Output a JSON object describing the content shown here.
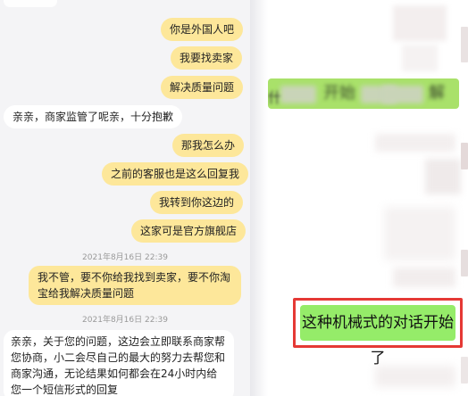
{
  "chat": {
    "messages": [
      {
        "side": "right",
        "text": "你是外国人吧"
      },
      {
        "side": "right",
        "text": "我要找卖家"
      },
      {
        "side": "right",
        "text": "解决质量问题"
      },
      {
        "side": "left",
        "text": "亲亲，商家监管了呢亲，十分抱歉"
      },
      {
        "side": "right",
        "text": "那我怎么办"
      },
      {
        "side": "right",
        "text": "之前的客服也是这么回复我"
      },
      {
        "side": "right",
        "text": "我转到你这边的"
      },
      {
        "side": "right",
        "text": "这家可是官方旗舰店"
      },
      {
        "side": "right",
        "text": "我不管，要不你给我找到卖家，要不你淘宝给我解决质量问题"
      },
      {
        "side": "left",
        "text": "亲亲，关于您的问题，这边会立即联系商家帮您协商，小二会尽自己的最大的努力去帮您和商家沟通，无论结果如何都会在24小时内给您一个短信形式的回复"
      }
    ],
    "timestamps": [
      "2021年8月16日 22:39",
      "2021年8月16日 22:39"
    ]
  },
  "right_panel": {
    "highlighted_message": "这种机械式的对话开始了",
    "blurred_fragment_1": "开始",
    "blurred_fragment_2": "解",
    "blurred_fragment_3": "什"
  },
  "colors": {
    "user_bubble": "#fde79a",
    "agent_bubble": "#ffffff",
    "wechat_green": "#95ec69",
    "highlight_border": "#e53935"
  }
}
